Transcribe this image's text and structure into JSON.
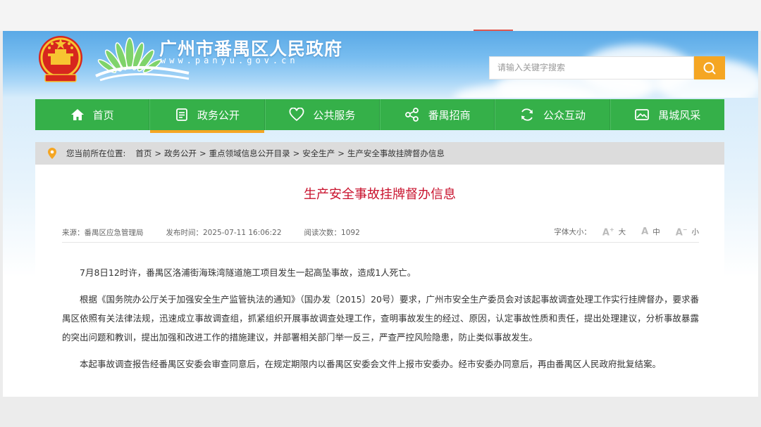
{
  "site": {
    "title": "广州市番禺区人民政府",
    "url": "www.panyu.gov.cn"
  },
  "search": {
    "placeholder": "请输入关键字搜索",
    "icon": "search-icon"
  },
  "nav": {
    "items": [
      {
        "label": "首页",
        "icon": "home-icon"
      },
      {
        "label": "政务公开",
        "icon": "document-icon"
      },
      {
        "label": "公共服务",
        "icon": "heart-icon"
      },
      {
        "label": "番禺招商",
        "icon": "network-icon"
      },
      {
        "label": "公众互动",
        "icon": "refresh-icon"
      },
      {
        "label": "禺城风采",
        "icon": "picture-icon"
      }
    ],
    "active_index": 1
  },
  "breadcrumb": {
    "prefix": "您当前所在位置:",
    "items": [
      "首页",
      "政务公开",
      "重点领域信息公开目录",
      "安全生产",
      "生产安全事故挂牌督办信息"
    ],
    "separator": ">"
  },
  "article": {
    "title": "生产安全事故挂牌督办信息",
    "source": "来源：番禺区应急管理局",
    "published": "发布时间：2025-07-11 16:06:22",
    "views": "阅读次数：1092",
    "font_size_label": "字体大小：",
    "font_sizes": [
      "大",
      "中",
      "小"
    ],
    "paragraphs": [
      "7月8日12时许，番禺区洛浦街海珠湾隧道施工项目发生一起高坠事故，造成1人死亡。",
      "根据《国务院办公厅关于加强安全生产监管执法的通知》（国办发〔2015〕20号）要求，广州市安全生产委员会对该起事故调查处理工作实行挂牌督办，要求番禺区依照有关法律法规，迅速成立事故调查组，抓紧组织开展事故调查处理工作，查明事故发生的经过、原因，认定事故性质和责任，提出处理建议，分析事故暴露的突出问题和教训，提出加强和改进工作的措施建议，并部署相关部门举一反三，严查严控风险隐患，防止类似事故发生。",
      "本起事故调查报告经番禺区安委会审查同意后，在规定期限内以番禺区安委会文件上报市安委办。经市安委办同意后，再由番禺区人民政府批复结案。"
    ]
  },
  "colors": {
    "nav_green": "#35b049",
    "accent_orange": "#f5a623",
    "title_red": "#c9132e"
  }
}
